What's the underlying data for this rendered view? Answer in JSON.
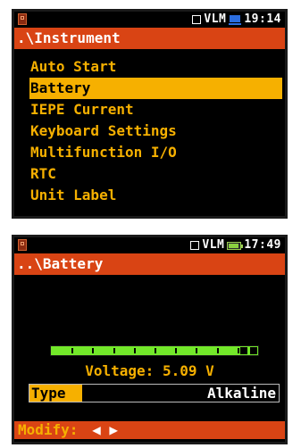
{
  "screen1": {
    "status": {
      "vlm": "VLM",
      "time": "19:14"
    },
    "title": ".\\Instrument",
    "menu": [
      {
        "label": "Auto Start"
      },
      {
        "label": "Battery"
      },
      {
        "label": "IEPE Current"
      },
      {
        "label": "Keyboard Settings"
      },
      {
        "label": "Multifunction I/O"
      },
      {
        "label": "RTC"
      },
      {
        "label": "Unit Label"
      }
    ],
    "selected_item": "Battery"
  },
  "screen2": {
    "status": {
      "vlm": "VLM",
      "time": "17:49"
    },
    "title": "..\\Battery",
    "battery_level": 0.93,
    "voltage_text": "Voltage:  5.09 V",
    "type_label": "Type",
    "type_value": "Alkaline",
    "modify_label": "Modify:",
    "modify_arrows": "◀ ▶"
  },
  "colors": {
    "accent_red": "#d94414",
    "highlight_yellow": "#f6b000",
    "bar_green": "#73e82a"
  },
  "icons": [
    "sd-card-icon",
    "display-square-icon",
    "pc-connection-icon",
    "battery-icon",
    "left-arrow-icon",
    "right-arrow-icon"
  ]
}
